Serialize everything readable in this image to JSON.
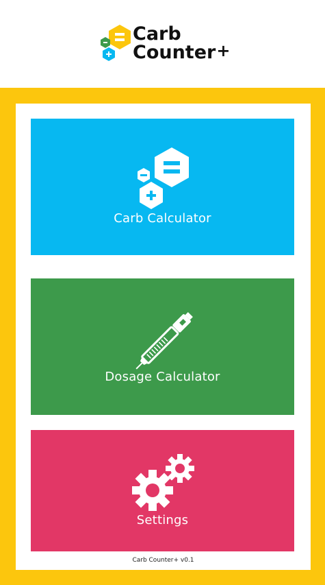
{
  "brand": {
    "line1": "Carb",
    "line2": "Counter",
    "plus": "+",
    "colors": {
      "yellow": "#FCC60D",
      "green": "#3D9A4B",
      "blue": "#07B8F1",
      "text": "#111111"
    }
  },
  "tiles": [
    {
      "label": "Carb Calculator",
      "icon": "carb-hexagons-icon",
      "color": "#07B8F1"
    },
    {
      "label": "Dosage Calculator",
      "icon": "insulin-pen-icon",
      "color": "#3D9A4B"
    },
    {
      "label": "Settings",
      "icon": "gears-icon",
      "color": "#E23766"
    }
  ],
  "footer": {
    "version_text": "Carb Counter+ v0.1"
  },
  "frame_color": "#FCC60D"
}
